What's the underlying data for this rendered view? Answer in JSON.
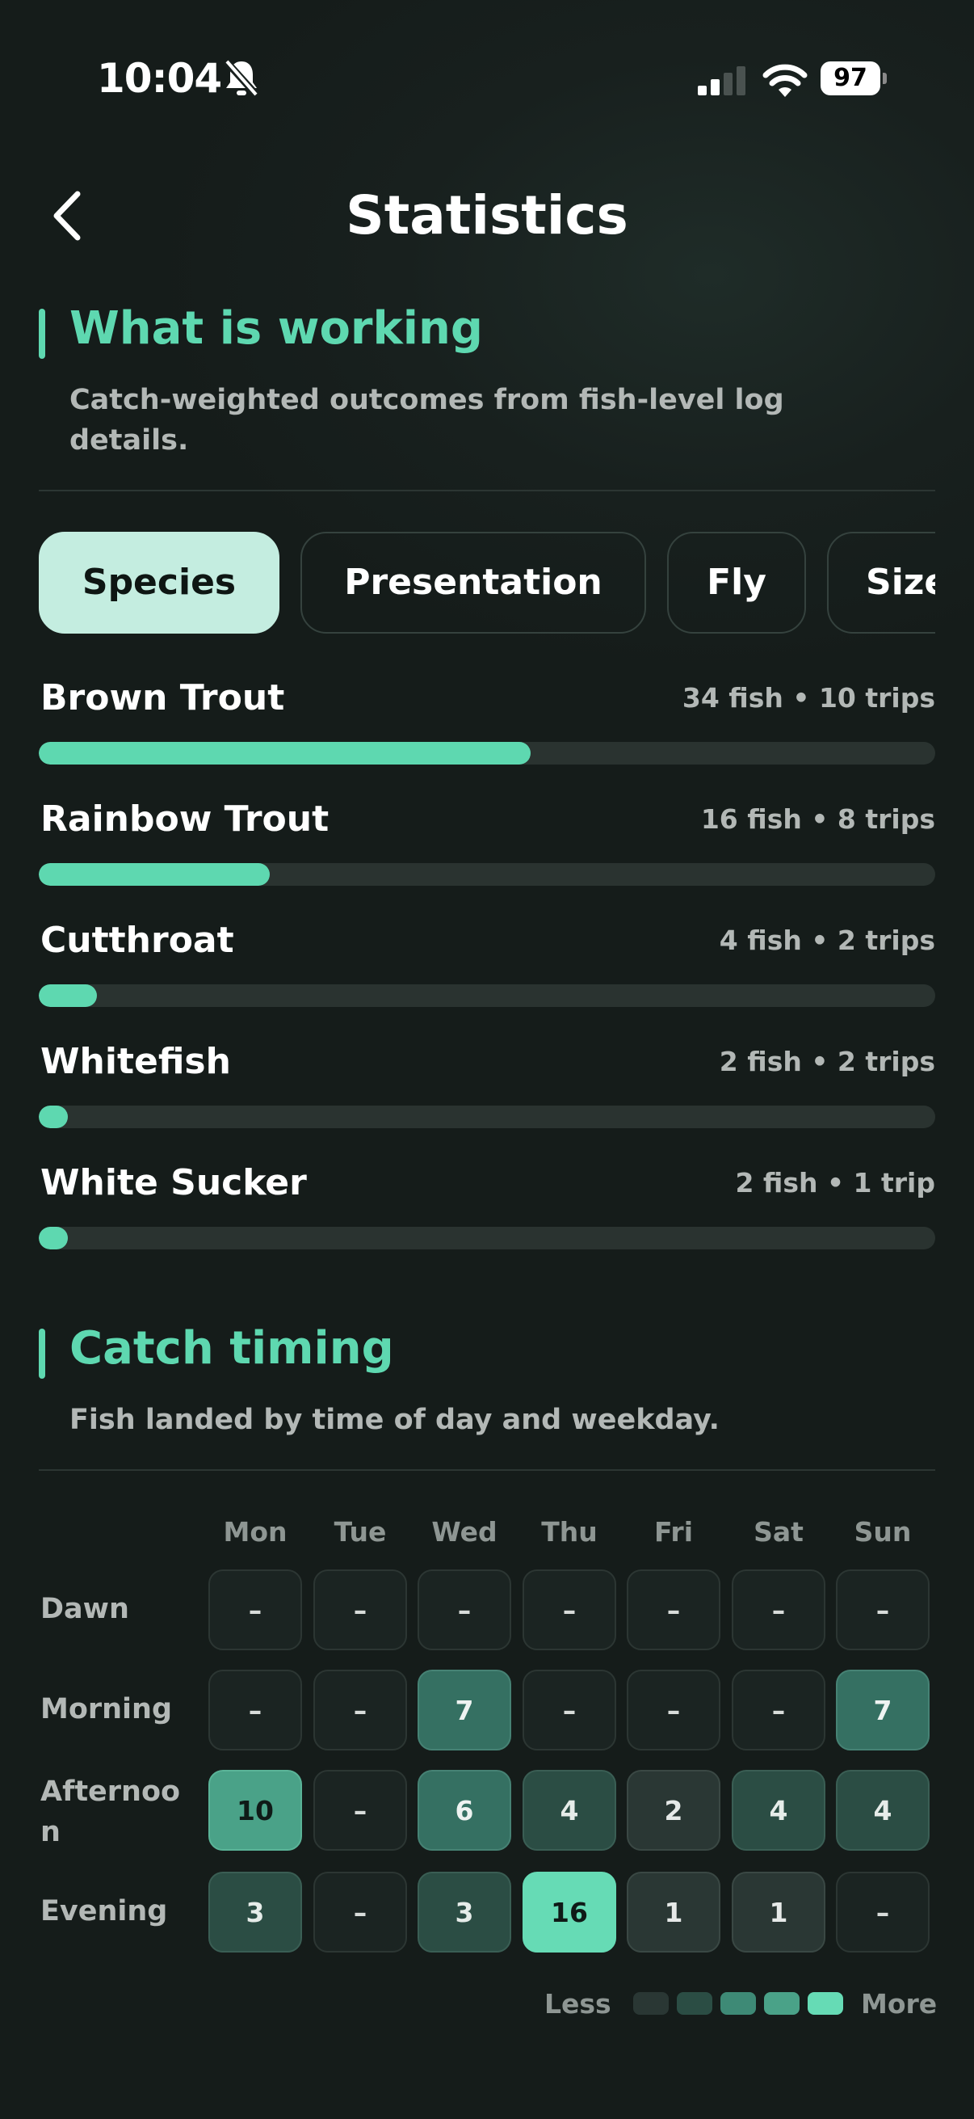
{
  "status_bar": {
    "time": "10:04",
    "battery": "97"
  },
  "header": {
    "title": "Statistics",
    "back_icon": "chevron-left-icon"
  },
  "what_is_working": {
    "title": "What is working",
    "subtitle": "Catch-weighted outcomes from fish-level log details.",
    "tabs": [
      {
        "label": "Species",
        "active": true
      },
      {
        "label": "Presentation",
        "active": false
      },
      {
        "label": "Fly",
        "active": false
      },
      {
        "label": "Size",
        "active": false
      }
    ],
    "max_fish": 62,
    "rows": [
      {
        "label": "Brown Trout",
        "meta": "34 fish • 10 trips",
        "fish": 34
      },
      {
        "label": "Rainbow Trout",
        "meta": "16 fish • 8 trips",
        "fish": 16
      },
      {
        "label": "Cutthroat",
        "meta": "4 fish • 2 trips",
        "fish": 4
      },
      {
        "label": "Whitefish",
        "meta": "2 fish • 2 trips",
        "fish": 2
      },
      {
        "label": "White Sucker",
        "meta": "2 fish • 1 trip",
        "fish": 2
      }
    ]
  },
  "catch_timing": {
    "title": "Catch timing",
    "subtitle": "Fish landed by time of day and weekday.",
    "days": [
      "Mon",
      "Tue",
      "Wed",
      "Thu",
      "Fri",
      "Sat",
      "Sun"
    ],
    "slots": [
      {
        "label": "Dawn",
        "values": [
          "–",
          "–",
          "–",
          "–",
          "–",
          "–",
          "–"
        ]
      },
      {
        "label": "Morning",
        "values": [
          "–",
          "–",
          "7",
          "–",
          "–",
          "–",
          "7"
        ]
      },
      {
        "label": "Afternoon",
        "values": [
          "10",
          "–",
          "6",
          "4",
          "2",
          "4",
          "4"
        ]
      },
      {
        "label": "Evening",
        "values": [
          "3",
          "–",
          "3",
          "16",
          "1",
          "1",
          "–"
        ]
      }
    ],
    "legend": {
      "less": "Less",
      "more": "More"
    }
  },
  "colors": {
    "accent": "#5ed8b0",
    "heat_levels": [
      "#1b2422",
      "#2a3734",
      "#2b4d44",
      "#357062",
      "#4aa288",
      "#66dbb5"
    ]
  }
}
